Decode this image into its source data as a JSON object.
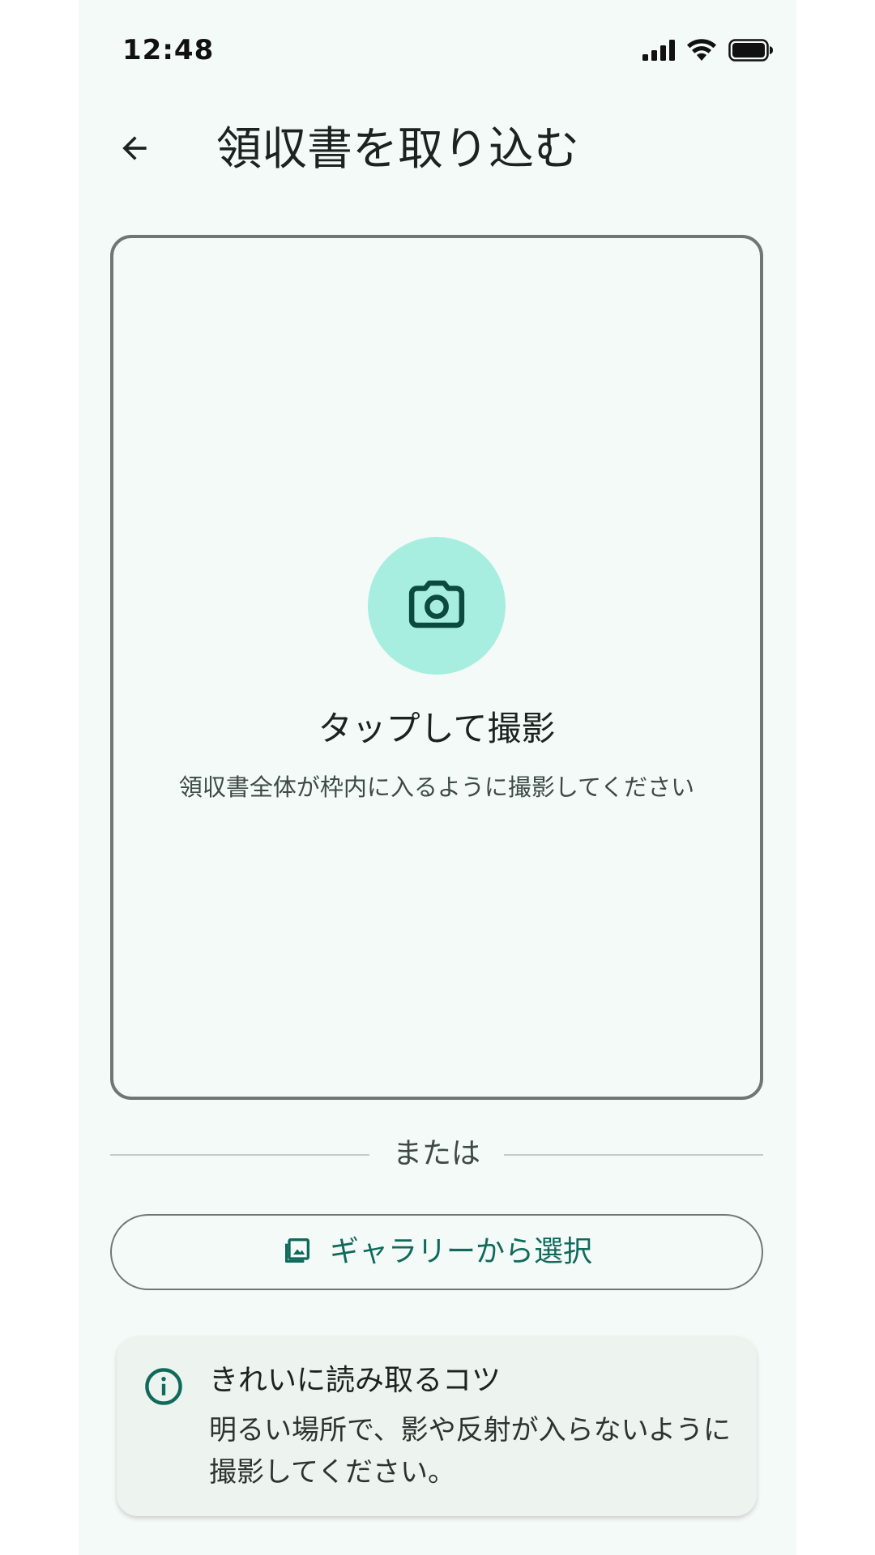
{
  "status_bar": {
    "time": "12:48"
  },
  "app_bar": {
    "title": "領収書を取り込む",
    "back_icon": "arrow-left-icon"
  },
  "capture": {
    "icon": "camera-icon",
    "title": "タップして撮影",
    "subtitle": "領収書全体が枠内に入るように撮影してください"
  },
  "divider": {
    "label": "または"
  },
  "gallery_button": {
    "icon": "gallery-icon",
    "label": "ギャラリーから選択"
  },
  "tip": {
    "icon": "info-icon",
    "title": "きれいに読み取るコツ",
    "body": "明るい場所で、影や反射が入らないように撮影してください。"
  },
  "colors": {
    "background": "#f4faf8",
    "accent": "#106a5b",
    "camera_circle": "#a7eee0",
    "tip_card": "#edf3ef"
  }
}
